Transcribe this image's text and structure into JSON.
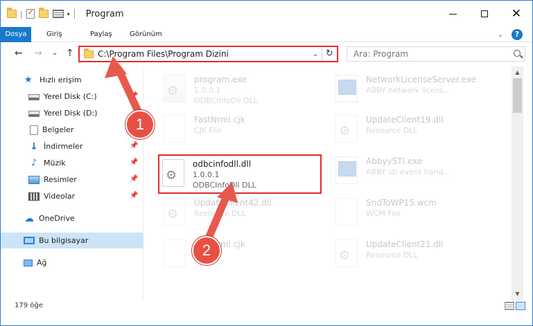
{
  "window": {
    "title": "Program",
    "qa_sep": "|"
  },
  "ribbon": {
    "tabs": [
      {
        "label": "Dosya"
      },
      {
        "label": "Giriş"
      },
      {
        "label": "Paylaş"
      },
      {
        "label": "Görünüm"
      }
    ],
    "help": "?"
  },
  "nav": {
    "back": "←",
    "forward": "→",
    "dropdown": "⌄",
    "up": "↑",
    "address": "C:\\Program Files\\Program Dizini",
    "refresh": "↻",
    "search_placeholder": "Ara: Program"
  },
  "sidebar": {
    "items": [
      {
        "label": "Hızlı erişim",
        "icon": "star-icon"
      },
      {
        "label": "Yerel Disk (C:)",
        "icon": "disk-icon"
      },
      {
        "label": "Yerel Disk (D:)",
        "icon": "disk-icon"
      },
      {
        "label": "Belgeler",
        "icon": "documents-icon"
      },
      {
        "label": "İndirmeler",
        "icon": "downloads-icon"
      },
      {
        "label": "Müzik",
        "icon": "music-icon"
      },
      {
        "label": "Resimler",
        "icon": "pictures-icon"
      },
      {
        "label": "Videolar",
        "icon": "videos-icon"
      },
      {
        "label": "OneDrive",
        "icon": "cloud-icon"
      },
      {
        "label": "Bu bilgisayar",
        "icon": "computer-icon"
      },
      {
        "label": "Ağ",
        "icon": "network-icon"
      }
    ]
  },
  "files": [
    {
      "name": "program.exe",
      "line1": "1.0.0.1",
      "line2": "ODBCInfoDll DLL"
    },
    {
      "name": "NetworkLicenseServer.exe",
      "line1": "ABBY network licens...",
      "line2": ""
    },
    {
      "name": "FastNrml.cjk",
      "line1": "CJK File",
      "line2": ""
    },
    {
      "name": "UpdateClient19.dll",
      "line1": "Resource DLL",
      "line2": ""
    },
    {
      "name": "odbcinfodll.dll",
      "line1": "1.0.0.1",
      "line2": "ODBCInfoDll DLL"
    },
    {
      "name": "AbbyySTI.exe",
      "line1": "ABBY sti event hand...",
      "line2": ""
    },
    {
      "name": "UpdateClient42.dll",
      "line1": "Resource DLL",
      "line2": ""
    },
    {
      "name": "SndToWP15.wcm",
      "line1": "WCM File",
      "line2": ""
    },
    {
      "name": "FastNrml.cjk",
      "line1": "",
      "line2": ""
    },
    {
      "name": "UpdateClient21.dll",
      "line1": "Resource DLL",
      "line2": ""
    }
  ],
  "annotations": {
    "step1": "1",
    "step2": "2"
  },
  "status": {
    "count": "179 öğe"
  },
  "colors": {
    "accent": "#1979ca",
    "highlight": "#e32a2a",
    "badge": "#e85045"
  }
}
